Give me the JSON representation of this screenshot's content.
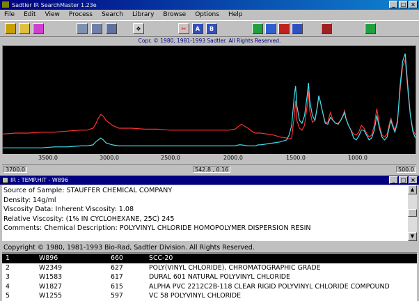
{
  "window": {
    "title": "Sadtler IR SearchMaster 1.23e",
    "controls": [
      "_",
      "□",
      "×"
    ]
  },
  "menu": [
    "File",
    "Edit",
    "View",
    "Process",
    "Search",
    "Library",
    "Browse",
    "Options",
    "Help"
  ],
  "toolbar": {
    "groups": [
      [
        "open-icon",
        "folder-icon",
        "print-icon"
      ],
      [
        "search-icon",
        "library-search-icon",
        "search-options-icon"
      ],
      [
        "move-icon"
      ],
      [
        "cut-peaks-icon",
        "airplane-icon",
        "compare-icon"
      ],
      [
        "zoom-icon",
        "zoom-in-icon",
        "zoom-out-icon",
        "zoom-fit-icon"
      ],
      [
        "book-icon"
      ],
      [
        "chart-icon"
      ]
    ]
  },
  "copyright_top": "Copr. © 1980, 1981-1993 Sadtler. All Rights Reserved.",
  "axis": {
    "ticks": [
      "3500.0",
      "3000.0",
      "2500.0",
      "2000.0",
      "1500.0",
      "1000.0"
    ],
    "left_limit": "3700.0",
    "cursor_readout": "542.8 , 0.16",
    "right_limit": "500.0"
  },
  "colors": {
    "unknown_spectrum": "#ff3030",
    "library_spectrum": "#40e0f0",
    "plot_background": "#000000"
  },
  "chart_data": {
    "type": "line",
    "xlim": [
      3700,
      500
    ],
    "series": [
      {
        "color": "#ff3030",
        "x": [
          3700,
          3600,
          3500,
          3400,
          3300,
          3200,
          3100,
          3050,
          3000,
          2980,
          2960,
          2940,
          2920,
          2900,
          2850,
          2800,
          2700,
          2600,
          2500,
          2400,
          2300,
          2200,
          2100,
          2000,
          1950,
          1900,
          1870,
          1850,
          1800,
          1780,
          1760,
          1740,
          1720,
          1700,
          1650,
          1600,
          1550,
          1500,
          1480,
          1460,
          1440,
          1430,
          1420,
          1400,
          1380,
          1360,
          1340,
          1330,
          1320,
          1300,
          1280,
          1260,
          1250,
          1240,
          1220,
          1200,
          1180,
          1160,
          1140,
          1120,
          1100,
          1080,
          1060,
          1050,
          1040,
          1020,
          1000,
          980,
          960,
          940,
          920,
          900,
          880,
          860,
          840,
          820,
          800,
          780,
          760,
          740,
          720,
          700,
          690,
          680,
          660,
          640,
          620,
          600,
          580,
          560,
          540,
          520,
          500
        ],
        "y": [
          0.16,
          0.17,
          0.17,
          0.18,
          0.18,
          0.19,
          0.2,
          0.2,
          0.22,
          0.26,
          0.32,
          0.36,
          0.34,
          0.3,
          0.25,
          0.22,
          0.22,
          0.21,
          0.21,
          0.2,
          0.2,
          0.2,
          0.2,
          0.2,
          0.2,
          0.21,
          0.24,
          0.26,
          0.22,
          0.2,
          0.18,
          0.17,
          0.17,
          0.17,
          0.16,
          0.15,
          0.13,
          0.12,
          0.11,
          0.12,
          0.35,
          0.5,
          0.3,
          0.22,
          0.2,
          0.25,
          0.45,
          0.6,
          0.4,
          0.28,
          0.3,
          0.45,
          0.55,
          0.5,
          0.38,
          0.28,
          0.28,
          0.38,
          0.3,
          0.27,
          0.27,
          0.3,
          0.36,
          0.4,
          0.33,
          0.25,
          0.2,
          0.16,
          0.15,
          0.18,
          0.25,
          0.22,
          0.17,
          0.13,
          0.15,
          0.25,
          0.42,
          0.25,
          0.15,
          0.13,
          0.16,
          0.28,
          0.32,
          0.27,
          0.2,
          0.3,
          0.6,
          0.85,
          0.92,
          0.6,
          0.35,
          0.2,
          0.15
        ]
      },
      {
        "color": "#40e0f0",
        "x": [
          3700,
          3600,
          3500,
          3400,
          3300,
          3200,
          3100,
          3050,
          3000,
          2980,
          2960,
          2940,
          2920,
          2900,
          2850,
          2800,
          2700,
          2600,
          2500,
          2400,
          2300,
          2200,
          2100,
          2000,
          1950,
          1900,
          1870,
          1850,
          1800,
          1780,
          1760,
          1740,
          1720,
          1700,
          1650,
          1600,
          1550,
          1500,
          1480,
          1460,
          1440,
          1430,
          1420,
          1400,
          1380,
          1360,
          1340,
          1330,
          1320,
          1300,
          1280,
          1260,
          1250,
          1240,
          1220,
          1200,
          1180,
          1160,
          1140,
          1120,
          1100,
          1080,
          1060,
          1050,
          1040,
          1020,
          1000,
          980,
          960,
          940,
          920,
          900,
          880,
          860,
          840,
          820,
          800,
          780,
          760,
          740,
          720,
          700,
          690,
          680,
          660,
          640,
          620,
          600,
          580,
          560,
          540,
          520,
          500
        ],
        "y": [
          0.02,
          0.02,
          0.02,
          0.02,
          0.03,
          0.03,
          0.04,
          0.04,
          0.05,
          0.08,
          0.1,
          0.12,
          0.1,
          0.07,
          0.05,
          0.04,
          0.04,
          0.04,
          0.04,
          0.04,
          0.04,
          0.04,
          0.04,
          0.04,
          0.04,
          0.04,
          0.05,
          0.05,
          0.04,
          0.04,
          0.04,
          0.04,
          0.05,
          0.05,
          0.06,
          0.07,
          0.08,
          0.1,
          0.15,
          0.25,
          0.55,
          0.65,
          0.45,
          0.3,
          0.27,
          0.35,
          0.55,
          0.68,
          0.5,
          0.35,
          0.3,
          0.45,
          0.55,
          0.5,
          0.38,
          0.27,
          0.26,
          0.33,
          0.3,
          0.27,
          0.26,
          0.3,
          0.35,
          0.38,
          0.32,
          0.25,
          0.2,
          0.12,
          0.1,
          0.14,
          0.2,
          0.2,
          0.15,
          0.1,
          0.12,
          0.2,
          0.35,
          0.22,
          0.13,
          0.1,
          0.13,
          0.25,
          0.3,
          0.25,
          0.18,
          0.28,
          0.65,
          0.9,
          0.98,
          0.65,
          0.35,
          0.18,
          0.12
        ]
      }
    ]
  },
  "result_window": {
    "title": "IR : TEMP.HIT - W896",
    "controls": [
      "_",
      "□",
      "×"
    ],
    "lines": [
      "Source of Sample: STAUFFER CHEMICAL COMPANY",
      "Density: 14g/ml",
      "Viscosity Data: Inherent Viscosity: 1.08",
      "Relative Viscosity: (1% IN CYCLOHEXANE, 25C) 245",
      "Comments: Chemical Description: POLYVINYL CHLORIDE HOMOPOLYMER DISPERSION RESIN"
    ]
  },
  "hits": {
    "header": "Copyright © 1980, 1981-1993 Bio-Rad, Sadtler Division.  All Rights Reserved.",
    "rows": [
      {
        "rank": "1",
        "id": "W896",
        "score": "660",
        "name": "SCC-20"
      },
      {
        "rank": "2",
        "id": "W2349",
        "score": "627",
        "name": "POLY(VINYL CHLORIDE), CHROMATOGRAPHIC GRADE"
      },
      {
        "rank": "3",
        "id": "W1583",
        "score": "617",
        "name": "DURAL 601 NATURAL POLYVINYL CHLORIDE"
      },
      {
        "rank": "4",
        "id": "W1827",
        "score": "615",
        "name": "ALPHA PVC 2212C2B-118 CLEAR RIGID POLYVINYL CHLORIDE COMPOUND"
      },
      {
        "rank": "5",
        "id": "W1255",
        "score": "597",
        "name": "VC 58 POLYVINYL CHLORIDE"
      }
    ]
  }
}
